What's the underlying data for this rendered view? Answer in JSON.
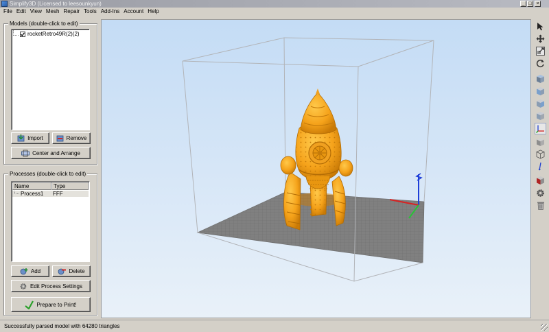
{
  "window": {
    "title": "Simplify3D (Licensed to leesounkyun)"
  },
  "menu": [
    "File",
    "Edit",
    "View",
    "Mesh",
    "Repair",
    "Tools",
    "Add-Ins",
    "Account",
    "Help"
  ],
  "models": {
    "title": "Models (double-click to edit)",
    "items": [
      {
        "name": "rocketRetro49R(2)(2)",
        "checked": true
      }
    ],
    "import_label": "Import",
    "remove_label": "Remove",
    "center_label": "Center and Arrange"
  },
  "processes": {
    "title": "Processes (double-click to edit)",
    "col_name": "Name",
    "col_type": "Type",
    "rows": [
      {
        "name": "Process1",
        "type": "FFF"
      }
    ],
    "add_label": "Add",
    "delete_label": "Delete",
    "edit_label": "Edit Process Settings",
    "prepare_label": "Prepare to Print!"
  },
  "toolbar_icons": [
    "select-arrow-icon",
    "move-icon",
    "scale-icon",
    "rotate-icon",
    "view-cube-top-icon",
    "view-cube-front-icon",
    "view-cube-side-icon",
    "view-cube-iso-icon",
    "axes-icon",
    "solid-view-icon",
    "wireframe-view-icon",
    "cross-section-icon",
    "build-volume-icon",
    "settings-gear-icon",
    "delete-trash-icon"
  ],
  "status": {
    "message": "Successfully parsed model with 64280 triangles"
  },
  "colors": {
    "model": "#f5a21a",
    "bed": "#7f7f7f",
    "viewport_top": "#c4dcf5",
    "viewport_bottom": "#e9f1f9"
  }
}
